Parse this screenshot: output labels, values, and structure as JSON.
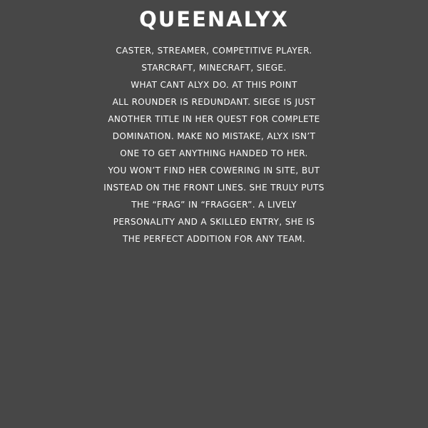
{
  "profile": {
    "name": "QUEENALYX",
    "bio_lines": [
      "CASTER, STREAMER, COMPETITIVE PLAYER.",
      "STARCRAFT, MINECRAFT, SIEGE.",
      "WHAT CANT ALYX DO. AT THIS POINT",
      "ALL ROUNDER IS REDUNDANT. SIEGE IS JUST",
      "ANOTHER TITLE IN HER QUEST FOR COMPLETE",
      "DOMINATION. MAKE NO MISTAKE, ALYX ISN’T",
      "ONE TO GET ANYTHING HANDED TO HER.",
      "YOU WON’T FIND HER COWERING IN SITE, BUT",
      "INSTEAD ON THE FRONT LINES. SHE TRULY PUTS",
      "THE “FRAG” IN “FRAGGER”. A LIVELY",
      "PERSONALITY AND A SKILLED ENTRY, SHE IS",
      "THE PERFECT ADDITION FOR ANY TEAM."
    ]
  },
  "theme": {
    "background": "#474747",
    "text": "#ffffff"
  }
}
